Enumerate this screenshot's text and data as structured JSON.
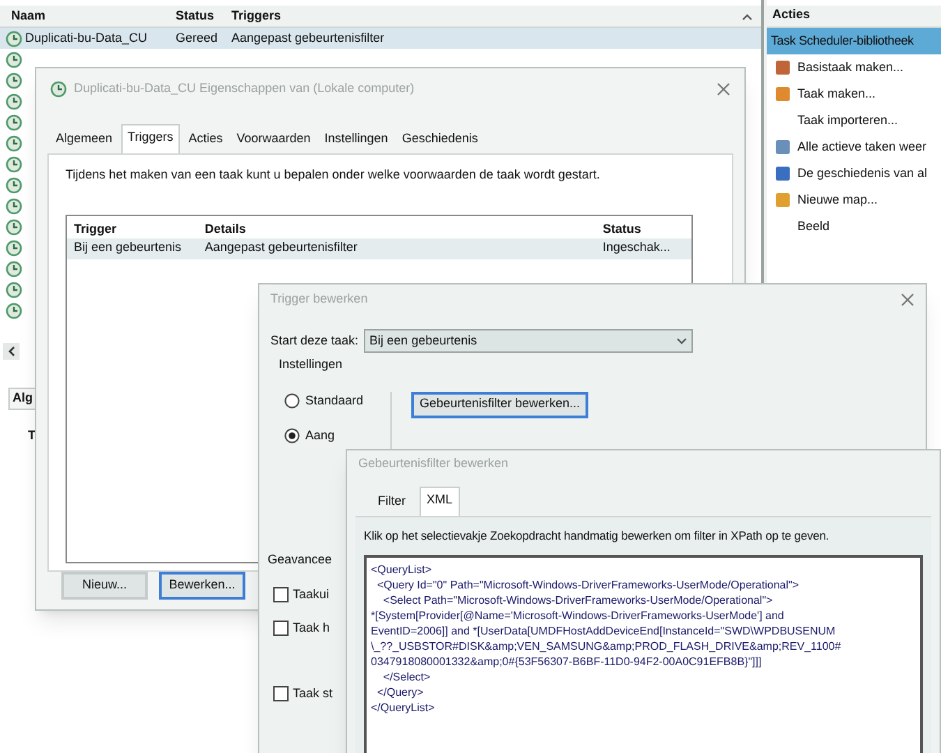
{
  "task_list": {
    "columns": [
      "Naam",
      "Status",
      "Triggers"
    ],
    "rows": [
      {
        "name": "Duplicati-bu-Data_CU",
        "status": "Gereed",
        "triggers": "Aangepast gebeurtenisfilter",
        "selected": true
      }
    ]
  },
  "lower_pane": {
    "tab": "Alg",
    "text": "T"
  },
  "actions_pane": {
    "title": "Acties",
    "items": [
      {
        "label": "Task Scheduler-bibliotheek",
        "kind": "header",
        "selected": true
      },
      {
        "label": "Basistaak maken...",
        "kind": "icon",
        "selected": false
      },
      {
        "label": "Taak maken...",
        "kind": "icon",
        "selected": false
      },
      {
        "label": "Taak importeren...",
        "kind": "plain",
        "selected": false
      },
      {
        "label": "Alle actieve taken weer",
        "kind": "icon",
        "selected": false
      },
      {
        "label": "De geschiedenis van al",
        "kind": "icon",
        "selected": false
      },
      {
        "label": "Nieuwe map...",
        "kind": "icon",
        "selected": false
      },
      {
        "label": "Beeld",
        "kind": "plain",
        "selected": false
      }
    ]
  },
  "properties_dialog": {
    "title": "Duplicati-bu-Data_CU Eigenschappen van (Lokale computer)",
    "tabs": [
      {
        "label": "Algemeen",
        "selected": false
      },
      {
        "label": "Triggers",
        "selected": true
      },
      {
        "label": "Acties",
        "selected": false
      },
      {
        "label": "Voorwaarden",
        "selected": false
      },
      {
        "label": "Instellingen",
        "selected": false
      },
      {
        "label": "Geschiedenis",
        "selected": false
      }
    ],
    "description": "Tijdens het maken van een taak kunt u bepalen onder welke voorwaarden de taak wordt gestart.",
    "table": {
      "columns": [
        "Trigger",
        "Details",
        "Status"
      ],
      "rows": [
        {
          "trigger": "Bij een gebeurtenis",
          "details": "Aangepast gebeurtenisfilter",
          "status": "Ingeschak..."
        }
      ]
    },
    "buttons": [
      {
        "label": "Nieuw...",
        "focused": false
      },
      {
        "label": "Bewerken...",
        "focused": true
      }
    ]
  },
  "trigger_dialog": {
    "title": "Trigger bewerken",
    "start_label": "Start deze taak:",
    "start_value": "Bij een gebeurtenis",
    "settings_label": "Instellingen",
    "radios": [
      {
        "label": "Standaard",
        "selected": false
      },
      {
        "label": "Aang",
        "selected": true
      }
    ],
    "filter_button": "Gebeurtenisfilter bewerken...",
    "advanced_label": "Geavancee",
    "checkboxes": [
      {
        "label": "Taakui",
        "checked": false
      },
      {
        "label": "Taak h",
        "checked": false
      },
      {
        "label": "Taak st",
        "checked": false
      }
    ]
  },
  "filter_dialog": {
    "title": "Gebeurtenisfilter bewerken",
    "tabs": [
      {
        "label": "Filter",
        "selected": false
      },
      {
        "label": "XML",
        "selected": true
      }
    ],
    "description": "Klik op het selectievakje Zoekopdracht handmatig bewerken om filter in XPath op te geven.",
    "xml": [
      "<QueryList>",
      "  <Query Id=\"0\" Path=\"Microsoft-Windows-DriverFrameworks-UserMode/Operational\">",
      "    <Select Path=\"Microsoft-Windows-DriverFrameworks-UserMode/Operational\">",
      "*[System[Provider[@Name='Microsoft-Windows-DriverFrameworks-UserMode'] and",
      "EventID=2006]] and *[UserData[UMDFHostAddDeviceEnd[InstanceId=\"SWD\\WPDBUSENUM",
      "\\_??_USBSTOR#DISK&amp;VEN_SAMSUNG&amp;PROD_FLASH_DRIVE&amp;REV_1100#",
      "0347918080001332&amp;0#{53F56307-B6BF-11D0-94F2-00A0C91EFB8B}\"]]]",
      "    </Select>",
      "  </Query>",
      "</QueryList>"
    ]
  }
}
